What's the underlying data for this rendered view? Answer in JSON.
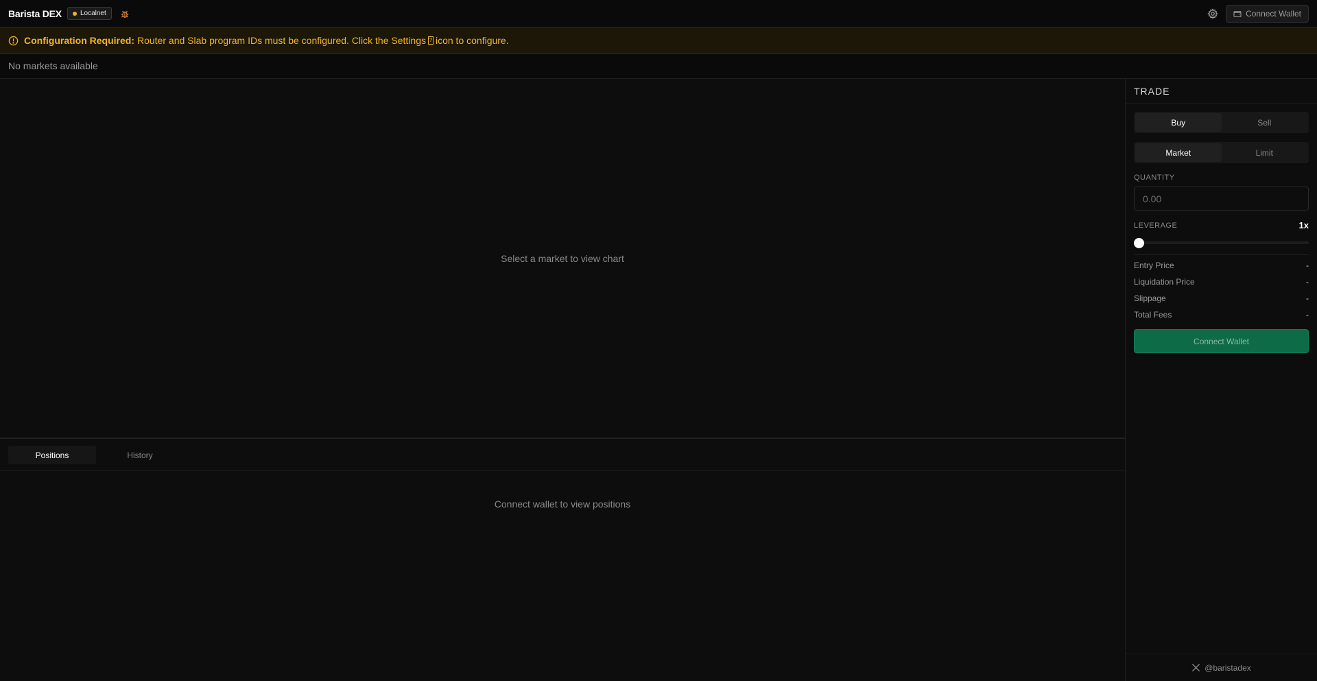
{
  "header": {
    "brand": "Barista DEX",
    "network": "Localnet",
    "connect_label": "Connect Wallet"
  },
  "banner": {
    "title": "Configuration Required:",
    "message_before": "Router and Slab program IDs must be configured. Click the Settings",
    "message_after": "icon to configure."
  },
  "market_bar": {
    "text": "No markets available"
  },
  "chart": {
    "empty_text": "Select a market to view chart"
  },
  "bottom": {
    "tabs": [
      {
        "label": "Positions",
        "active": true
      },
      {
        "label": "History",
        "active": false
      }
    ],
    "empty_text": "Connect wallet to view positions"
  },
  "trade": {
    "title": "TRADE",
    "side": {
      "buy": "Buy",
      "sell": "Sell",
      "selected": "Buy"
    },
    "order_type": {
      "market": "Market",
      "limit": "Limit",
      "selected": "Market"
    },
    "quantity": {
      "label": "QUANTITY",
      "placeholder": "0.00",
      "value": ""
    },
    "leverage": {
      "label": "LEVERAGE",
      "value": "1x",
      "level": 0
    },
    "info": {
      "entry_price_label": "Entry Price",
      "entry_price": "-",
      "liquidation_price_label": "Liquidation Price",
      "liquidation_price": "-",
      "slippage_label": "Slippage",
      "slippage": "-",
      "total_fees_label": "Total Fees",
      "total_fees": "-"
    },
    "connect_label": "Connect Wallet",
    "footer_handle": "@baristadex"
  },
  "colors": {
    "accent_warning": "#f0b429",
    "connect_green": "#0e6b47",
    "background": "#0d0d0d"
  },
  "icons": {
    "bug": "bug-icon",
    "settings": "gear-icon",
    "wallet": "wallet-icon",
    "warning": "warning-circle-icon",
    "x": "x-logo-icon"
  }
}
